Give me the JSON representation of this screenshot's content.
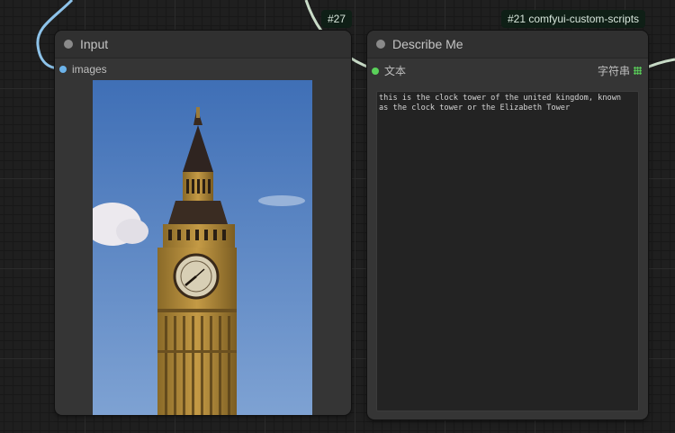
{
  "badges": {
    "left": "#27",
    "right": "#21 comfyui-custom-scripts"
  },
  "input_node": {
    "title": "Input",
    "output_slot": "images",
    "image_alt": "Big Ben clock tower against blue sky"
  },
  "describe_node": {
    "title": "Describe Me",
    "input_slot": "文本",
    "output_slot": "字符串",
    "text_value": "this is the clock tower of the united kingdom, known\nas the clock tower or the Elizabeth Tower"
  },
  "colors": {
    "image_slot": "#6cb3ea",
    "string_slot": "#5ad15a",
    "link_blue": "#8dc3ea",
    "link_pale": "#c9dcc8"
  },
  "icons": [
    "collapse-dot-icon",
    "grid-icon"
  ]
}
